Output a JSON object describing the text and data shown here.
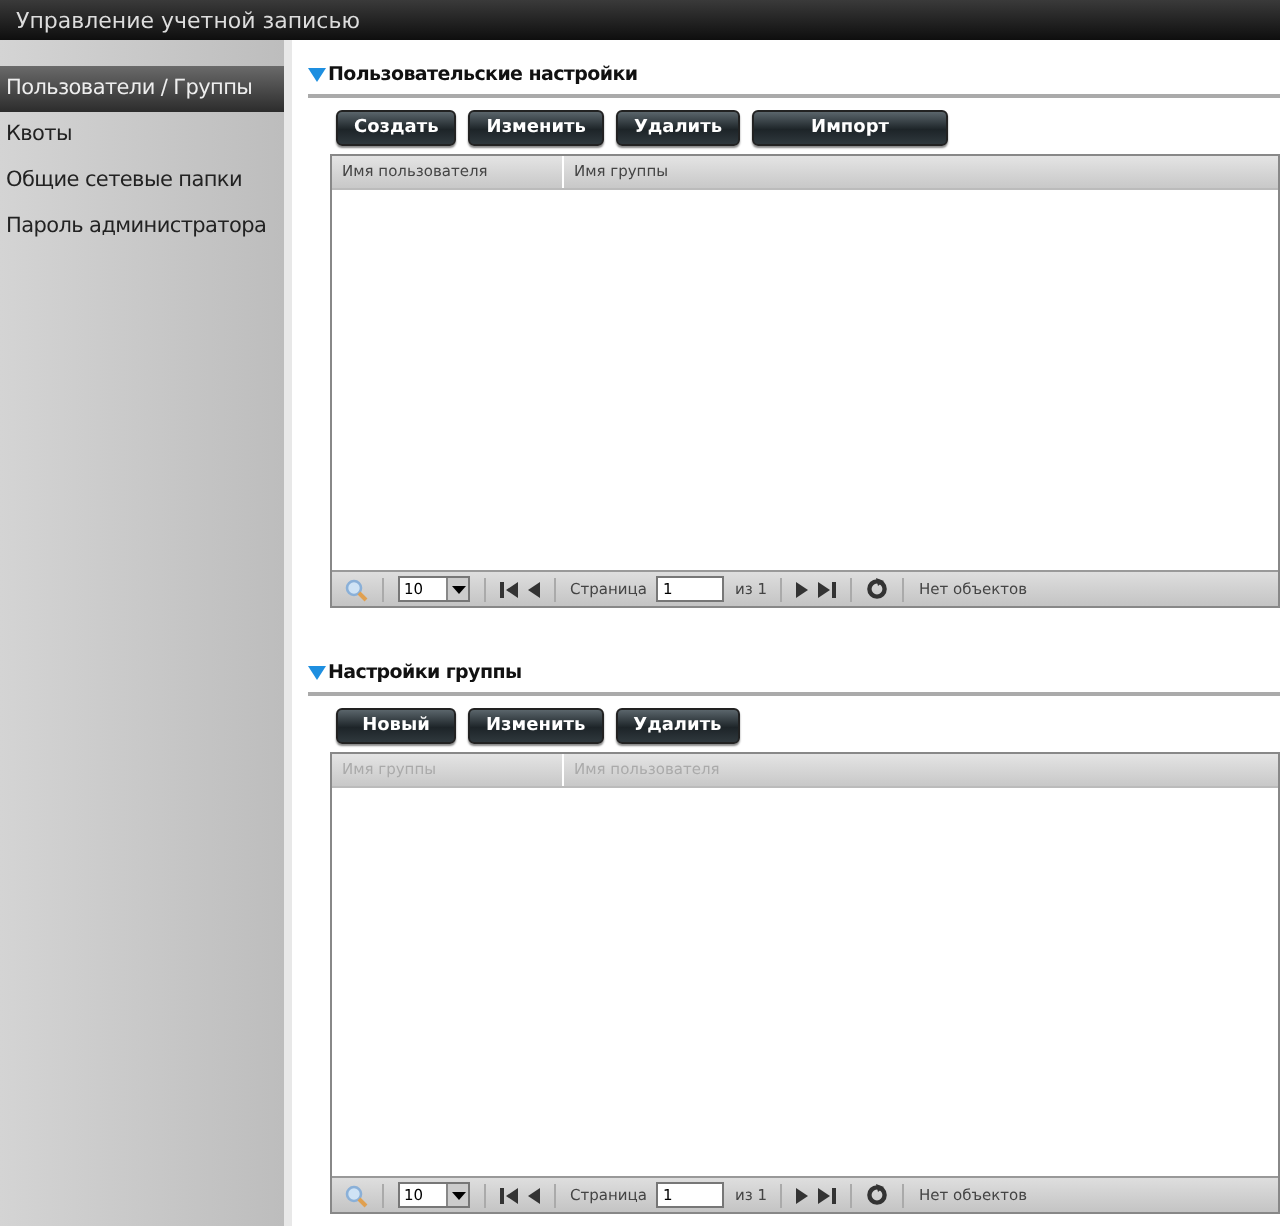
{
  "window": {
    "title": "Управление учетной записью"
  },
  "sidebar": {
    "items": [
      {
        "label": "Пользователи / Группы",
        "selected": true
      },
      {
        "label": "Квоты",
        "selected": false
      },
      {
        "label": "Общие сетевые папки",
        "selected": false
      },
      {
        "label": "Пароль администратора",
        "selected": false
      }
    ]
  },
  "sections": [
    {
      "title": "Пользовательские настройки",
      "buttons": [
        "Создать",
        "Изменить",
        "Удалить",
        "Импорт"
      ],
      "table": {
        "disabled": false,
        "columns": [
          "Имя пользователя",
          "Имя группы"
        ]
      },
      "pager": {
        "page_size": "10",
        "page_label": "Страница",
        "page": "1",
        "of": "из 1",
        "status": "Нет объектов"
      }
    },
    {
      "title": "Настройки группы",
      "buttons": [
        "Новый",
        "Изменить",
        "Удалить"
      ],
      "table": {
        "disabled": true,
        "columns": [
          "Имя группы",
          "Имя пользователя"
        ]
      },
      "pager": {
        "page_size": "10",
        "page_label": "Страница",
        "page": "1",
        "of": "из 1",
        "status": "Нет объектов"
      }
    }
  ]
}
